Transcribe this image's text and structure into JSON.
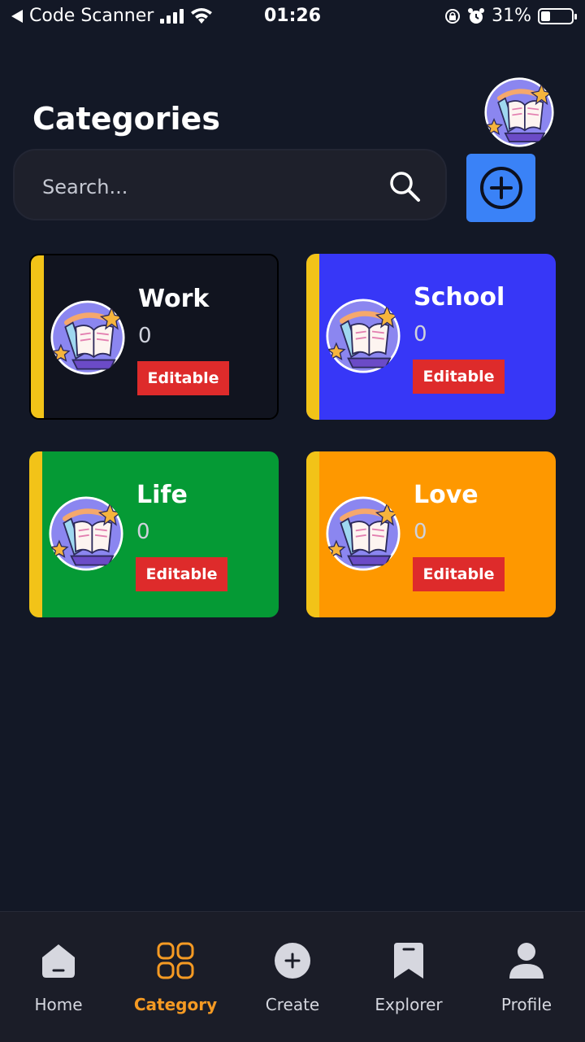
{
  "status_bar": {
    "back_app": "Code Scanner",
    "time": "01:26",
    "battery": "31%",
    "battery_level": 0.31
  },
  "header": {
    "title": "Categories"
  },
  "search": {
    "placeholder": "Search..."
  },
  "categories": [
    {
      "name": "Work",
      "count": "0",
      "tag": "Editable",
      "color": "#11141f"
    },
    {
      "name": "School",
      "count": "0",
      "tag": "Editable",
      "color": "#3737f7"
    },
    {
      "name": "Life",
      "count": "0",
      "tag": "Editable",
      "color": "#059a35"
    },
    {
      "name": "Love",
      "count": "0",
      "tag": "Editable",
      "color": "#fe9800"
    }
  ],
  "nav": {
    "items": [
      {
        "label": "Home",
        "icon": "home-icon"
      },
      {
        "label": "Category",
        "icon": "category-grid-icon",
        "active": true
      },
      {
        "label": "Create",
        "icon": "create-plus-icon"
      },
      {
        "label": "Explorer",
        "icon": "bookmark-icon"
      },
      {
        "label": "Profile",
        "icon": "profile-icon"
      }
    ]
  },
  "colors": {
    "background": "#131826",
    "accent_blue": "#3a82f7",
    "accent_orange": "#f59a23",
    "tag_red": "#de2b2b",
    "stripe_yellow": "#f2c318"
  }
}
